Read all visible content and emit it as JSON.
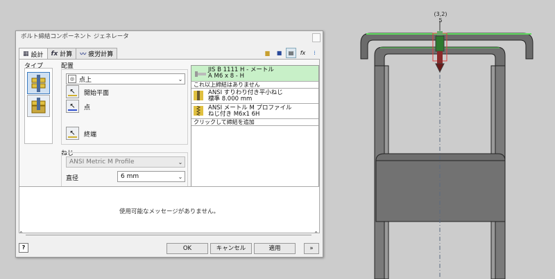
{
  "dialog": {
    "title": "ボルト締結コンポーネント ジェネレータ",
    "tabs": [
      {
        "label": "設計",
        "icon": "design-icon"
      },
      {
        "label": "計算",
        "icon": "fx-icon"
      },
      {
        "label": "疲労計算",
        "icon": "fatigue-icon"
      }
    ],
    "type_label": "タイプ",
    "placement": {
      "label": "配置",
      "selected": "点上",
      "start_plane": "開始平面",
      "point": "点",
      "termination": "終端"
    },
    "thread": {
      "label": "ねじ",
      "type_value": "ANSI Metric M Profile",
      "diameter_label": "直径",
      "diameter_value": "6 mm"
    },
    "stack": [
      {
        "line1": "JIS B 1111 H - メートル",
        "line2": "A M6 x 8 - H",
        "style": "green"
      },
      {
        "line1": "これ以上締結はありません",
        "style": "plain"
      },
      {
        "line1": "ANSI すりわり付き平小ねじ",
        "line2": "標準 8.000 mm",
        "style": "item"
      },
      {
        "line1": "ANSI メートル M プロファイル",
        "line2": "ねじ付き M6x1 6H",
        "style": "item"
      },
      {
        "line1": "クリックして締結を追加",
        "style": "plain"
      }
    ],
    "message": "使用可能なメッセージがありません。",
    "buttons": {
      "ok": "OK",
      "cancel": "キャンセル",
      "apply": "適用",
      "more": "»",
      "help": "?"
    }
  },
  "viewport": {
    "dimension_paren": "(3,2)",
    "dimension_value": "5"
  },
  "colors": {
    "selection_green": "#5fdc5f",
    "selected_blue": "#3a7abf",
    "part_gray": "#6b6b6b"
  }
}
